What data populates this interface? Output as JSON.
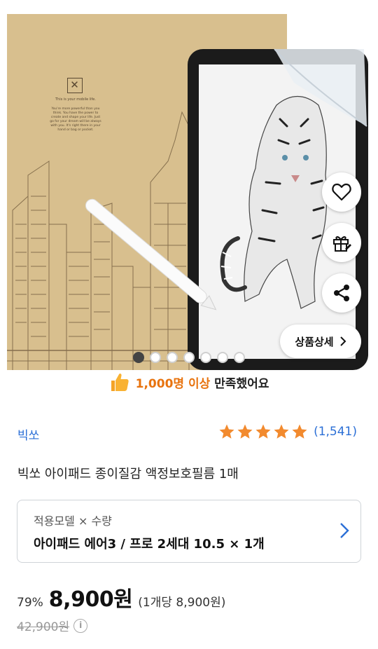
{
  "hero": {
    "image_description_icon": "product-photo",
    "brand_line": "This is your mobile life.",
    "brand_body": "You're more powerful than you think. You have the power to create and shape your life. Just go for your dream will be always with you. It's right there in your hand or bag or pocket.",
    "slide_count": 7,
    "active_slide": 1
  },
  "actions": {
    "like_icon": "heart-icon",
    "gift_icon": "gift-icon",
    "share_icon": "share-icon",
    "detail_label": "상품상세"
  },
  "satisfaction": {
    "highlight": "1,000명 이상",
    "rest": " 만족했어요"
  },
  "seller": {
    "name": "빅쏘"
  },
  "rating": {
    "stars": 5,
    "count": "(1,541)",
    "star_color": "#f28a2e"
  },
  "product": {
    "title": "빅쏘 아이패드 종이질감 액정보호필름 1매"
  },
  "option": {
    "label": "적용모델 × 수량",
    "value": "아이패드 에어3 / 프로 2세대 10.5 × 1개"
  },
  "price": {
    "discount": "79%",
    "sale": "8,900원",
    "unit": "(1개당 8,900원)",
    "original": "42,900원",
    "info_icon": "i"
  },
  "colors": {
    "accent_blue": "#2b6fd6",
    "accent_orange": "#e8730e"
  }
}
